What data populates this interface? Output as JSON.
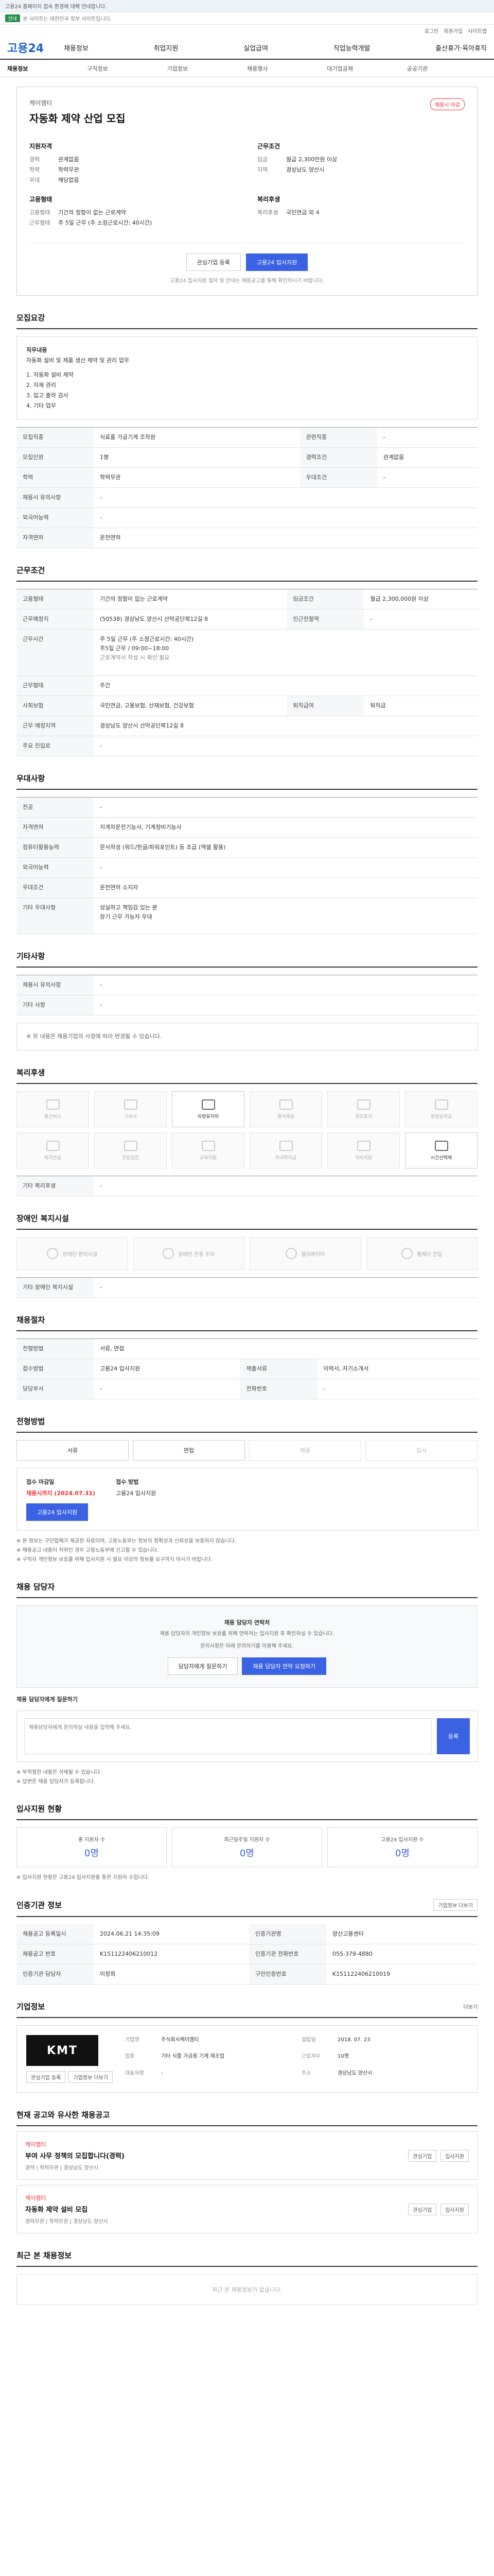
{
  "topbar": {
    "text": "고용24 홈페이지 접속 환경에 대해 안내합니다."
  },
  "banner": {
    "badge": "안내",
    "text": "본 사이트는 대한민국 정부 사이트입니다."
  },
  "util": {
    "links": [
      "로그인",
      "회원가입",
      "사이트맵"
    ]
  },
  "gnb": {
    "logo": "고용24",
    "menu": [
      "채용정보",
      "취업지원",
      "실업급여",
      "직업능력개발",
      "출산휴가·육아휴직"
    ]
  },
  "subnav": {
    "items": [
      "채용정보",
      "채용정보",
      "구직정보",
      "기업정보",
      "채용행사",
      "대기업공채",
      "공공기관"
    ]
  },
  "summary": {
    "company_label": "케이엠티",
    "title": "자동화 제약 산업 모집",
    "tag": "채용시 마감",
    "qual_title": "지원자격",
    "qual": [
      [
        "경력",
        "관계없음"
      ],
      [
        "학력",
        "학력무관"
      ],
      [
        "우대",
        "해당없음"
      ]
    ],
    "cond_title": "근무조건",
    "cond": [
      [
        "임금",
        "월급 2,300만원 이상"
      ],
      [
        "지역",
        "경상남도 양산시"
      ]
    ],
    "type_title": "고용형태",
    "type": [
      [
        "고용형태",
        "기간의 정함이 없는 근로계약"
      ],
      [
        "근무형태",
        "주 5일 근무 (주 소정근로시간: 40시간)"
      ]
    ],
    "welfare_title": "복리후생",
    "welfare": [
      [
        "복리후생",
        "국민연금 외 4"
      ]
    ],
    "scrap": "관심기업 등록",
    "apply": "고용24 입사지원",
    "note": "고용24 입사지원 절차 및 안내는 채용공고를 통해 확인하시기 바랍니다."
  },
  "jobdesc": {
    "title": "모집요강",
    "body_head": "직무내용",
    "body": "자동화 설비 및 제품 생산 제약 및 관리 업무",
    "lines": [
      "1. 자동화 설비 제약",
      "2. 자재 관리",
      "3. 입고 출하 검사",
      "4. 기타 업무"
    ]
  },
  "rows1": [
    [
      "모집직종",
      "식료품 가공기계 조작원",
      "관련직종",
      "-"
    ],
    [
      "모집인원",
      "1명",
      "경력조건",
      "관계없음"
    ],
    [
      "학력",
      "학력무관",
      "우대조건",
      "-"
    ],
    [
      "채용시 유의사항",
      "-",
      "",
      ""
    ],
    [
      "외국어능력",
      "-",
      "",
      ""
    ],
    [
      "자격면허",
      "운전면허",
      "",
      ""
    ]
  ],
  "work": {
    "title": "근무조건",
    "rows": [
      [
        "고용형태",
        "기간의 정함이 없는 근로계약",
        "임금조건",
        "월급 2,300,000원 이상"
      ],
      [
        "근무예정지",
        "(50538) 경상남도 양산시 산막공단북12길 8",
        "인근전철역",
        "-"
      ],
      [
        "근무시간",
        "주 5일 근무 (주 소정근로시간: 40시간)",
        "",
        ""
      ],
      [
        "근무형태",
        "주간",
        "",
        ""
      ],
      [
        "사회보험",
        "국민연금, 고용보험, 산재보험, 건강보험",
        "퇴직급여",
        "퇴직금"
      ],
      [
        "근무 예정지역",
        "경상남도 양산시 산막공단북12길 8",
        "",
        ""
      ],
      [
        "주요 진입로",
        "-",
        "",
        ""
      ]
    ],
    "hours": "주5일 근무 / 09:00~18:00",
    "note": "근로계약서 작성 시 확인 필요"
  },
  "prefer": {
    "title": "우대사항",
    "rows": [
      [
        "전공",
        "-"
      ],
      [
        "자격면허",
        "지게차운전기능사, 기계정비기능사"
      ],
      [
        "컴퓨터활용능력",
        "문서작성 (워드/한글/파워포인트) 등 초급 (엑셀 활용)"
      ],
      [
        "외국어능력",
        "-"
      ],
      [
        "우대조건",
        "운전면허 소지자"
      ],
      [
        "기타 우대사항",
        "성실하고 책임감 있는 분\n장기 근무 가능자 우대"
      ]
    ]
  },
  "etc": {
    "title": "기타사항",
    "rows": [
      [
        "채용시 유의사항",
        "-"
      ],
      [
        "기타 사항",
        "-"
      ]
    ],
    "note": "※ 위 내용은 채용기업의 사정에 따라 변경될 수 있습니다."
  },
  "welfare": {
    "title": "복리후생",
    "items": [
      "통근버스",
      "기숙사",
      "차량유지비",
      "중식제공",
      "경조휴가",
      "명절상여금",
      "퇴직연금",
      "건강검진",
      "교육지원",
      "자녀학자금",
      "식비지원",
      "시간선택제"
    ],
    "on": [
      2,
      11
    ],
    "etc_title": "기타 복리후생",
    "etc": "-"
  },
  "disabled": {
    "title": "장애인 복지시설",
    "items": [
      "장애인 편의시설",
      "장애인 전용 주차",
      "엘리베이터",
      "휠체어 진입"
    ],
    "etc_title": "기타 장애인 복지시설",
    "etc": "-"
  },
  "process": {
    "title": "채용절차",
    "rows": [
      [
        "전형방법",
        "서류, 면접"
      ],
      [
        "접수방법",
        "고용24 입사지원"
      ],
      [
        "제출서류",
        "이력서, 자기소개서"
      ],
      [
        "담당부서",
        "-"
      ],
      [
        "전화번호",
        "-"
      ]
    ]
  },
  "steps": {
    "title": "전형방법",
    "items": [
      "서류",
      "면접",
      "채용",
      "입사"
    ],
    "on": [
      0,
      1
    ]
  },
  "applyinfo": {
    "period_label": "접수 마감일",
    "period": "채용시까지 (2024.07.31)",
    "method_label": "접수 방법",
    "method": "고용24 입사지원",
    "apply_btn": "고용24 입사지원"
  },
  "caution": {
    "lines": [
      "※ 본 정보는 구인업체가 제공한 자료이며, 고용노동부는 정보의 정확성과 신뢰성을 보증하지 않습니다.",
      "※ 채용공고 내용이 허위인 경우 고용노동부에 신고할 수 있습니다.",
      "※ 구직자 개인정보 보호를 위해 입사지원 시 필요 이상의 정보를 요구하지 마시기 바랍니다."
    ]
  },
  "contact": {
    "title": "채용 담당자",
    "head": "채용 담당자 연락처",
    "lines": [
      "채용 담당자의 개인정보 보호를 위해 연락처는 입사지원 후 확인하실 수 있습니다.",
      "문의사항은 아래 문의하기를 이용해 주세요."
    ],
    "btn1": "담당자에게 질문하기",
    "btn2": "채용 담당자 연락 요청하기"
  },
  "qa": {
    "label": "채용 담당자에게 질문하기",
    "placeholder": "채용담당자에게 문의하실 내용을 입력해 주세요.",
    "send": "등록",
    "notes": [
      "※ 부적절한 내용은 삭제될 수 있습니다.",
      "※ 답변은 채용 담당자가 등록합니다."
    ]
  },
  "stats": {
    "title": "입사지원 현황",
    "items": [
      [
        "총 지원자 수",
        "0명"
      ],
      [
        "최근일주일 지원자 수",
        "0명"
      ],
      [
        "고용24 입사지원 수",
        "0명"
      ]
    ],
    "note": "※ 입사지원 현황은 고용24 입사지원을 통한 지원자 수입니다."
  },
  "info": {
    "title": "인증기관 정보",
    "btn": "기업정보 더보기",
    "rows": [
      [
        "채용공고 등록일시",
        "2024.06.21 14:35:09",
        "인증기관명",
        "양산고용센터"
      ],
      [
        "채용공고 번호",
        "K151122406210012",
        "인증기관 전화번호",
        "055-379-4880"
      ],
      [
        "인증기관 담당자",
        "이정희",
        "구인인증번호",
        "K151122406210019"
      ]
    ]
  },
  "company": {
    "title": "기업정보",
    "more": "더보기",
    "logo": "KMT",
    "fields": [
      [
        "기업명",
        "주식회사케이엠티"
      ],
      [
        "업종",
        "기타 식품 가공용 기계 제조업"
      ],
      [
        "설립일",
        "2018. 07. 23"
      ],
      [
        "근로자수",
        "10명"
      ],
      [
        "대표자명",
        "-"
      ],
      [
        "주소",
        "경상남도 양산시"
      ]
    ],
    "btn1": "관심기업 등록",
    "btn2": "기업정보 더보기"
  },
  "recs": {
    "title": "현재 공고와 유사한 채용공고",
    "items": [
      {
        "co": "케이엠티",
        "title": "부여 사무 정책의 모집합니다(경력)",
        "meta": "경력 | 학력무관 | 경상남도 양산시",
        "b1": "관심기업",
        "b2": "입사지원"
      },
      {
        "co": "케이엠티",
        "title": "자동화 제약 설비 모집",
        "meta": "경력무관 | 학력무관 | 경상남도 양산시",
        "b1": "관심기업",
        "b2": "입사지원"
      }
    ]
  },
  "recent": {
    "title": "최근 본 채용정보",
    "empty": "최근 본 채용정보가 없습니다."
  }
}
